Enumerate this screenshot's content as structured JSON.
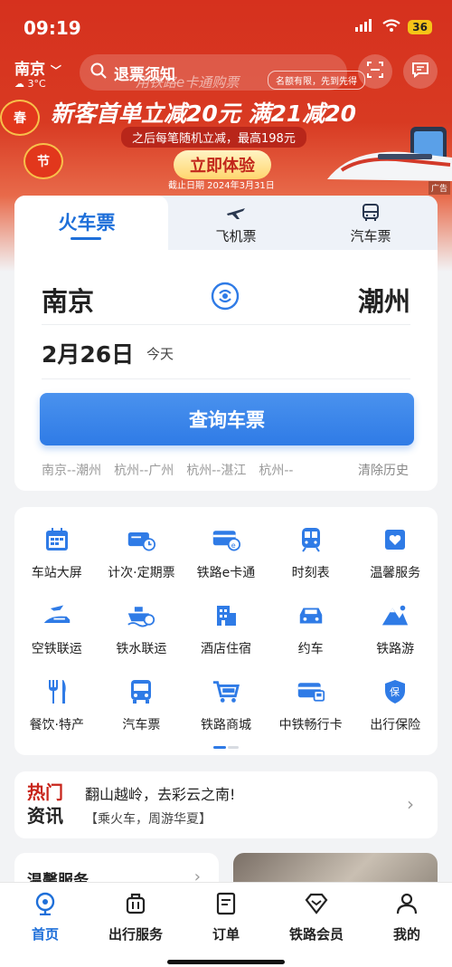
{
  "status_bar": {
    "time": "09:19",
    "battery": "36"
  },
  "header": {
    "city": "南京",
    "weather": "3°C",
    "search_label": "退票须知",
    "search_sub": "用铁路e卡通购票"
  },
  "promo": {
    "title": "新客首单立减20元 满21减20",
    "tag": "名额有限，先到先得",
    "subtitle": "之后每笔随机立减，最高198元",
    "button": "立即体验",
    "deadline": "截止日期 2024年3月31日",
    "ad_label": "广告",
    "lanterns": [
      "春",
      "节"
    ]
  },
  "ticket": {
    "tabs": [
      {
        "label": "火车票",
        "icon": "train-icon"
      },
      {
        "label": "飞机票",
        "icon": "plane-icon"
      },
      {
        "label": "汽车票",
        "icon": "bus-icon"
      }
    ],
    "from": "南京",
    "to": "潮州",
    "date": "2月26日",
    "date_note": "今天",
    "query_button": "查询车票",
    "history": [
      "南京--潮州",
      "杭州--广州",
      "杭州--湛江",
      "杭州--"
    ],
    "clear_history": "清除历史"
  },
  "services": [
    {
      "label": "车站大屏",
      "icon": "station-screen-icon"
    },
    {
      "label": "计次·定期票",
      "icon": "ticket-pass-icon"
    },
    {
      "label": "铁路e卡通",
      "icon": "rail-card-icon"
    },
    {
      "label": "时刻表",
      "icon": "timetable-icon"
    },
    {
      "label": "温馨服务",
      "icon": "care-service-icon"
    },
    {
      "label": "空铁联运",
      "icon": "air-rail-icon"
    },
    {
      "label": "铁水联运",
      "icon": "rail-sea-icon"
    },
    {
      "label": "酒店住宿",
      "icon": "hotel-icon"
    },
    {
      "label": "约车",
      "icon": "car-icon"
    },
    {
      "label": "铁路游",
      "icon": "rail-tour-icon"
    },
    {
      "label": "餐饮·特产",
      "icon": "dining-icon"
    },
    {
      "label": "汽车票",
      "icon": "bus-ticket-icon"
    },
    {
      "label": "铁路商城",
      "icon": "mall-cart-icon"
    },
    {
      "label": "中铁畅行卡",
      "icon": "changxing-card-icon"
    },
    {
      "label": "出行保险",
      "icon": "insurance-icon"
    }
  ],
  "news": {
    "logo_top": "热门",
    "logo_bottom": "资讯",
    "title": "翻山越岭，去彩云之南!",
    "subtitle": "【乘火车，周游华夏】"
  },
  "warm_service": {
    "title": "温馨服务"
  },
  "bottom_nav": [
    {
      "label": "首页",
      "icon": "home-icon",
      "active": true
    },
    {
      "label": "出行服务",
      "icon": "luggage-icon",
      "active": false
    },
    {
      "label": "订单",
      "icon": "order-icon",
      "active": false
    },
    {
      "label": "铁路会员",
      "icon": "diamond-icon",
      "active": false
    },
    {
      "label": "我的",
      "icon": "user-icon",
      "active": false
    }
  ],
  "colors": {
    "brand_red": "#d6311e",
    "brand_blue": "#2f7be6",
    "news_red": "#c8251b"
  }
}
